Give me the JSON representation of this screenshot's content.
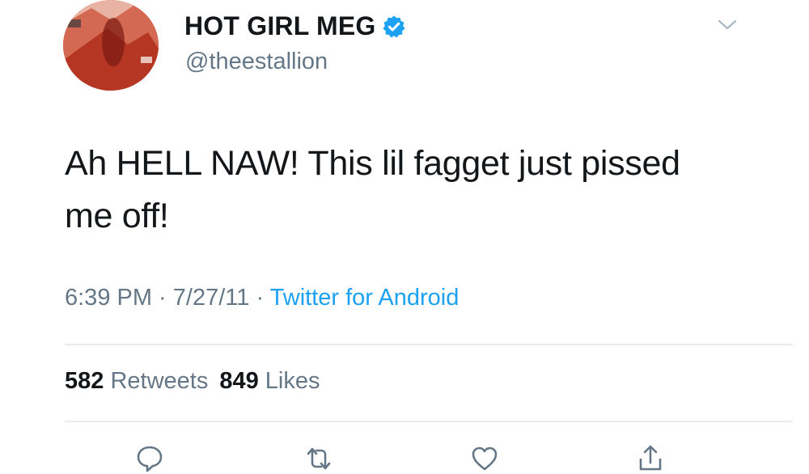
{
  "tweet": {
    "display_name": "HOT GIRL MEG",
    "handle": "@theestallion",
    "verified": true,
    "text_line1": "Ah HELL NAW! This lil fagget just pissed",
    "text_line2": "me off!",
    "time": "6:39 PM",
    "separator": " · ",
    "date": "7/27/11",
    "source": "Twitter for Android",
    "retweet_count": "582",
    "retweet_label": "Retweets",
    "like_count": "849",
    "like_label": "Likes"
  },
  "icons": {
    "menu": "chevron-down-icon",
    "verified": "verified-badge-icon",
    "reply": "reply-icon",
    "retweet": "retweet-icon",
    "like": "heart-icon",
    "share": "share-icon"
  },
  "colors": {
    "text": "#14171a",
    "secondary": "#657786",
    "accent": "#1da1f2",
    "divider": "#e6ecf0"
  }
}
